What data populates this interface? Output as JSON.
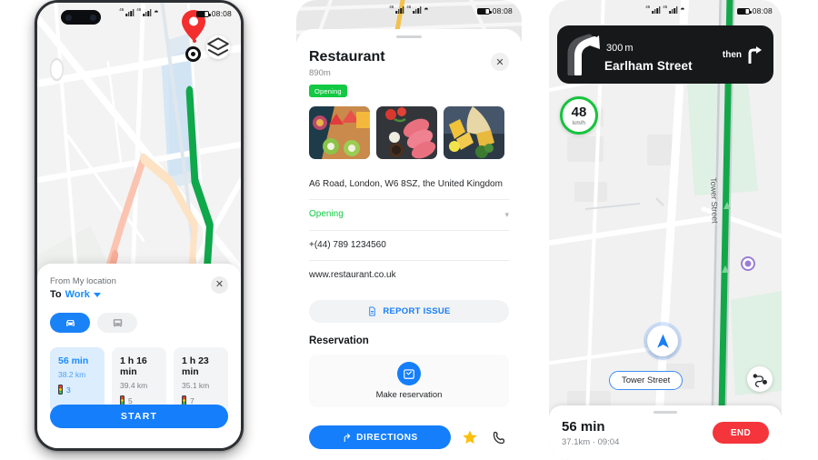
{
  "colors": {
    "blue": "#157efb",
    "green_route": "#12a84a",
    "red_pin": "#f32e2e",
    "green_badge": "#12c944",
    "red_end": "#f4353b",
    "speed_ring": "#15c43c",
    "dark_banner": "#17181a"
  },
  "status_bar": {
    "time": "08:08",
    "signal_label": "46",
    "wifi_icon": "wifi-icon",
    "battery_icon": "battery-icon"
  },
  "phone1": {
    "map": {
      "layers_icon": "layers-icon",
      "destination_pin_icon": "destination-pin-icon",
      "origin_dot_icon": "origin-dot-icon",
      "waypoint_icon": "waypoint-icon"
    },
    "route_panel": {
      "from_label": "From My location",
      "to_prefix": "To",
      "to_value": "Work",
      "dropdown_icon": "chevron-down-icon",
      "close_icon": "close-icon",
      "modes": [
        {
          "name": "car",
          "icon": "car-icon",
          "active": true
        },
        {
          "name": "transit",
          "icon": "bus-icon",
          "active": false
        }
      ],
      "routes": [
        {
          "time": "56 min",
          "distance": "38.2 km",
          "lights": "3",
          "selected": true
        },
        {
          "time": "1 h 16 min",
          "distance": "39.4 km",
          "lights": "5",
          "selected": false
        },
        {
          "time": "1 h 23 min",
          "distance": "35.1 km",
          "lights": "7",
          "selected": false
        }
      ],
      "start_label": "START"
    }
  },
  "phone2": {
    "title": "Restaurant",
    "distance": "890m",
    "status_badge": "Opening",
    "close_icon": "close-icon",
    "photos": [
      "fruit-platter-photo",
      "raw-tuna-photo",
      "fish-and-chips-photo",
      "cut-off-photo"
    ],
    "rows": {
      "address": "A6 Road, London, W6 8SZ, the United Kingdom",
      "hours": "Opening",
      "hours_chevron_icon": "chevron-down-icon",
      "phone": "+(44)  789 1234560",
      "website": "www.restaurant.co.uk"
    },
    "report_issue": {
      "label": "REPORT ISSUE",
      "icon": "document-icon"
    },
    "reservation": {
      "section_title": "Reservation",
      "icon": "calendar-check-icon",
      "label": "Make reservation"
    },
    "actions": {
      "directions_label": "DIRECTIONS",
      "directions_icon": "directions-arrow-icon",
      "favorite_icon": "star-icon",
      "call_icon": "phone-icon"
    }
  },
  "phone3": {
    "banner": {
      "maneuver_icon": "turn-slight-right-icon",
      "distance": "300",
      "distance_unit": "m",
      "street": "Earlham Street",
      "then_label": "then",
      "then_icon": "turn-right-icon"
    },
    "speed": {
      "value": "48",
      "unit": "km/h"
    },
    "map": {
      "street_label": "Tower Street",
      "puck_icon": "navigation-arrow-icon",
      "poi_icon": "poi-icon"
    },
    "street_pill": "Tower Street",
    "overview_icon": "route-overview-icon",
    "footer": {
      "eta_time": "56 min",
      "eta_detail": "37.1km  ·  09:04",
      "end_label": "END"
    }
  }
}
